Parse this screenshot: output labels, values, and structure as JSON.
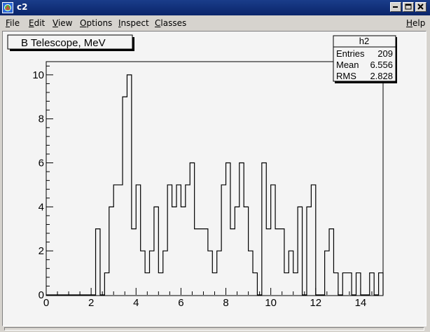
{
  "window": {
    "title": "c2",
    "buttons": [
      "minimize",
      "maximize",
      "close"
    ]
  },
  "menubar": {
    "items": [
      {
        "label": "File",
        "mnemonic": "F"
      },
      {
        "label": "Edit",
        "mnemonic": "E"
      },
      {
        "label": "View",
        "mnemonic": "V"
      },
      {
        "label": "Options",
        "mnemonic": "O"
      },
      {
        "label": "Inspect",
        "mnemonic": "I"
      },
      {
        "label": "Classes",
        "mnemonic": "C"
      }
    ],
    "help": {
      "label": "Help",
      "mnemonic": "H"
    }
  },
  "pad": {
    "title": "B Telescope, MeV"
  },
  "stats": {
    "name": "h2",
    "rows": [
      {
        "label": "Entries",
        "value": "209"
      },
      {
        "label": "Mean",
        "value": "6.556"
      },
      {
        "label": "RMS",
        "value": "2.828"
      }
    ]
  },
  "chart_data": {
    "type": "bar",
    "title": "B Telescope, MeV",
    "histogram": "h2",
    "xlim": [
      0,
      15
    ],
    "ylim": [
      0,
      10.6
    ],
    "bin_width": 0.2,
    "x_ticks": [
      0,
      2,
      4,
      6,
      8,
      10,
      12,
      14
    ],
    "y_ticks": [
      0,
      2,
      4,
      6,
      8,
      10
    ],
    "bins": [
      {
        "x": 2.0,
        "count": 0
      },
      {
        "x": 2.2,
        "count": 3
      },
      {
        "x": 2.4,
        "count": 0
      },
      {
        "x": 2.6,
        "count": 1
      },
      {
        "x": 2.8,
        "count": 4
      },
      {
        "x": 3.0,
        "count": 5
      },
      {
        "x": 3.2,
        "count": 5
      },
      {
        "x": 3.4,
        "count": 9
      },
      {
        "x": 3.6,
        "count": 10
      },
      {
        "x": 3.8,
        "count": 3
      },
      {
        "x": 4.0,
        "count": 5
      },
      {
        "x": 4.2,
        "count": 2
      },
      {
        "x": 4.4,
        "count": 1
      },
      {
        "x": 4.6,
        "count": 2
      },
      {
        "x": 4.8,
        "count": 4
      },
      {
        "x": 5.0,
        "count": 1
      },
      {
        "x": 5.2,
        "count": 2
      },
      {
        "x": 5.4,
        "count": 5
      },
      {
        "x": 5.6,
        "count": 4
      },
      {
        "x": 5.8,
        "count": 5
      },
      {
        "x": 6.0,
        "count": 4
      },
      {
        "x": 6.2,
        "count": 5
      },
      {
        "x": 6.4,
        "count": 6
      },
      {
        "x": 6.6,
        "count": 3
      },
      {
        "x": 6.8,
        "count": 3
      },
      {
        "x": 7.0,
        "count": 3
      },
      {
        "x": 7.2,
        "count": 2
      },
      {
        "x": 7.4,
        "count": 1
      },
      {
        "x": 7.6,
        "count": 2
      },
      {
        "x": 7.8,
        "count": 5
      },
      {
        "x": 8.0,
        "count": 6
      },
      {
        "x": 8.2,
        "count": 3
      },
      {
        "x": 8.4,
        "count": 4
      },
      {
        "x": 8.6,
        "count": 6
      },
      {
        "x": 8.8,
        "count": 4
      },
      {
        "x": 9.0,
        "count": 2
      },
      {
        "x": 9.2,
        "count": 1
      },
      {
        "x": 9.4,
        "count": 0
      },
      {
        "x": 9.6,
        "count": 6
      },
      {
        "x": 9.8,
        "count": 3
      },
      {
        "x": 10.0,
        "count": 5
      },
      {
        "x": 10.2,
        "count": 3
      },
      {
        "x": 10.4,
        "count": 3
      },
      {
        "x": 10.6,
        "count": 1
      },
      {
        "x": 10.8,
        "count": 2
      },
      {
        "x": 11.0,
        "count": 1
      },
      {
        "x": 11.2,
        "count": 4
      },
      {
        "x": 11.4,
        "count": 0
      },
      {
        "x": 11.6,
        "count": 4
      },
      {
        "x": 11.8,
        "count": 5
      },
      {
        "x": 12.0,
        "count": 0
      },
      {
        "x": 12.2,
        "count": 0
      },
      {
        "x": 12.4,
        "count": 2
      },
      {
        "x": 12.6,
        "count": 3
      },
      {
        "x": 12.8,
        "count": 1
      },
      {
        "x": 13.0,
        "count": 0
      },
      {
        "x": 13.2,
        "count": 1
      },
      {
        "x": 13.4,
        "count": 1
      },
      {
        "x": 13.6,
        "count": 0
      },
      {
        "x": 13.8,
        "count": 1
      },
      {
        "x": 14.0,
        "count": 0
      },
      {
        "x": 14.2,
        "count": 0
      },
      {
        "x": 14.4,
        "count": 1
      },
      {
        "x": 14.6,
        "count": 0
      },
      {
        "x": 14.8,
        "count": 1
      }
    ],
    "line_color": "#000000",
    "pad_color": "#f4f4f4"
  }
}
